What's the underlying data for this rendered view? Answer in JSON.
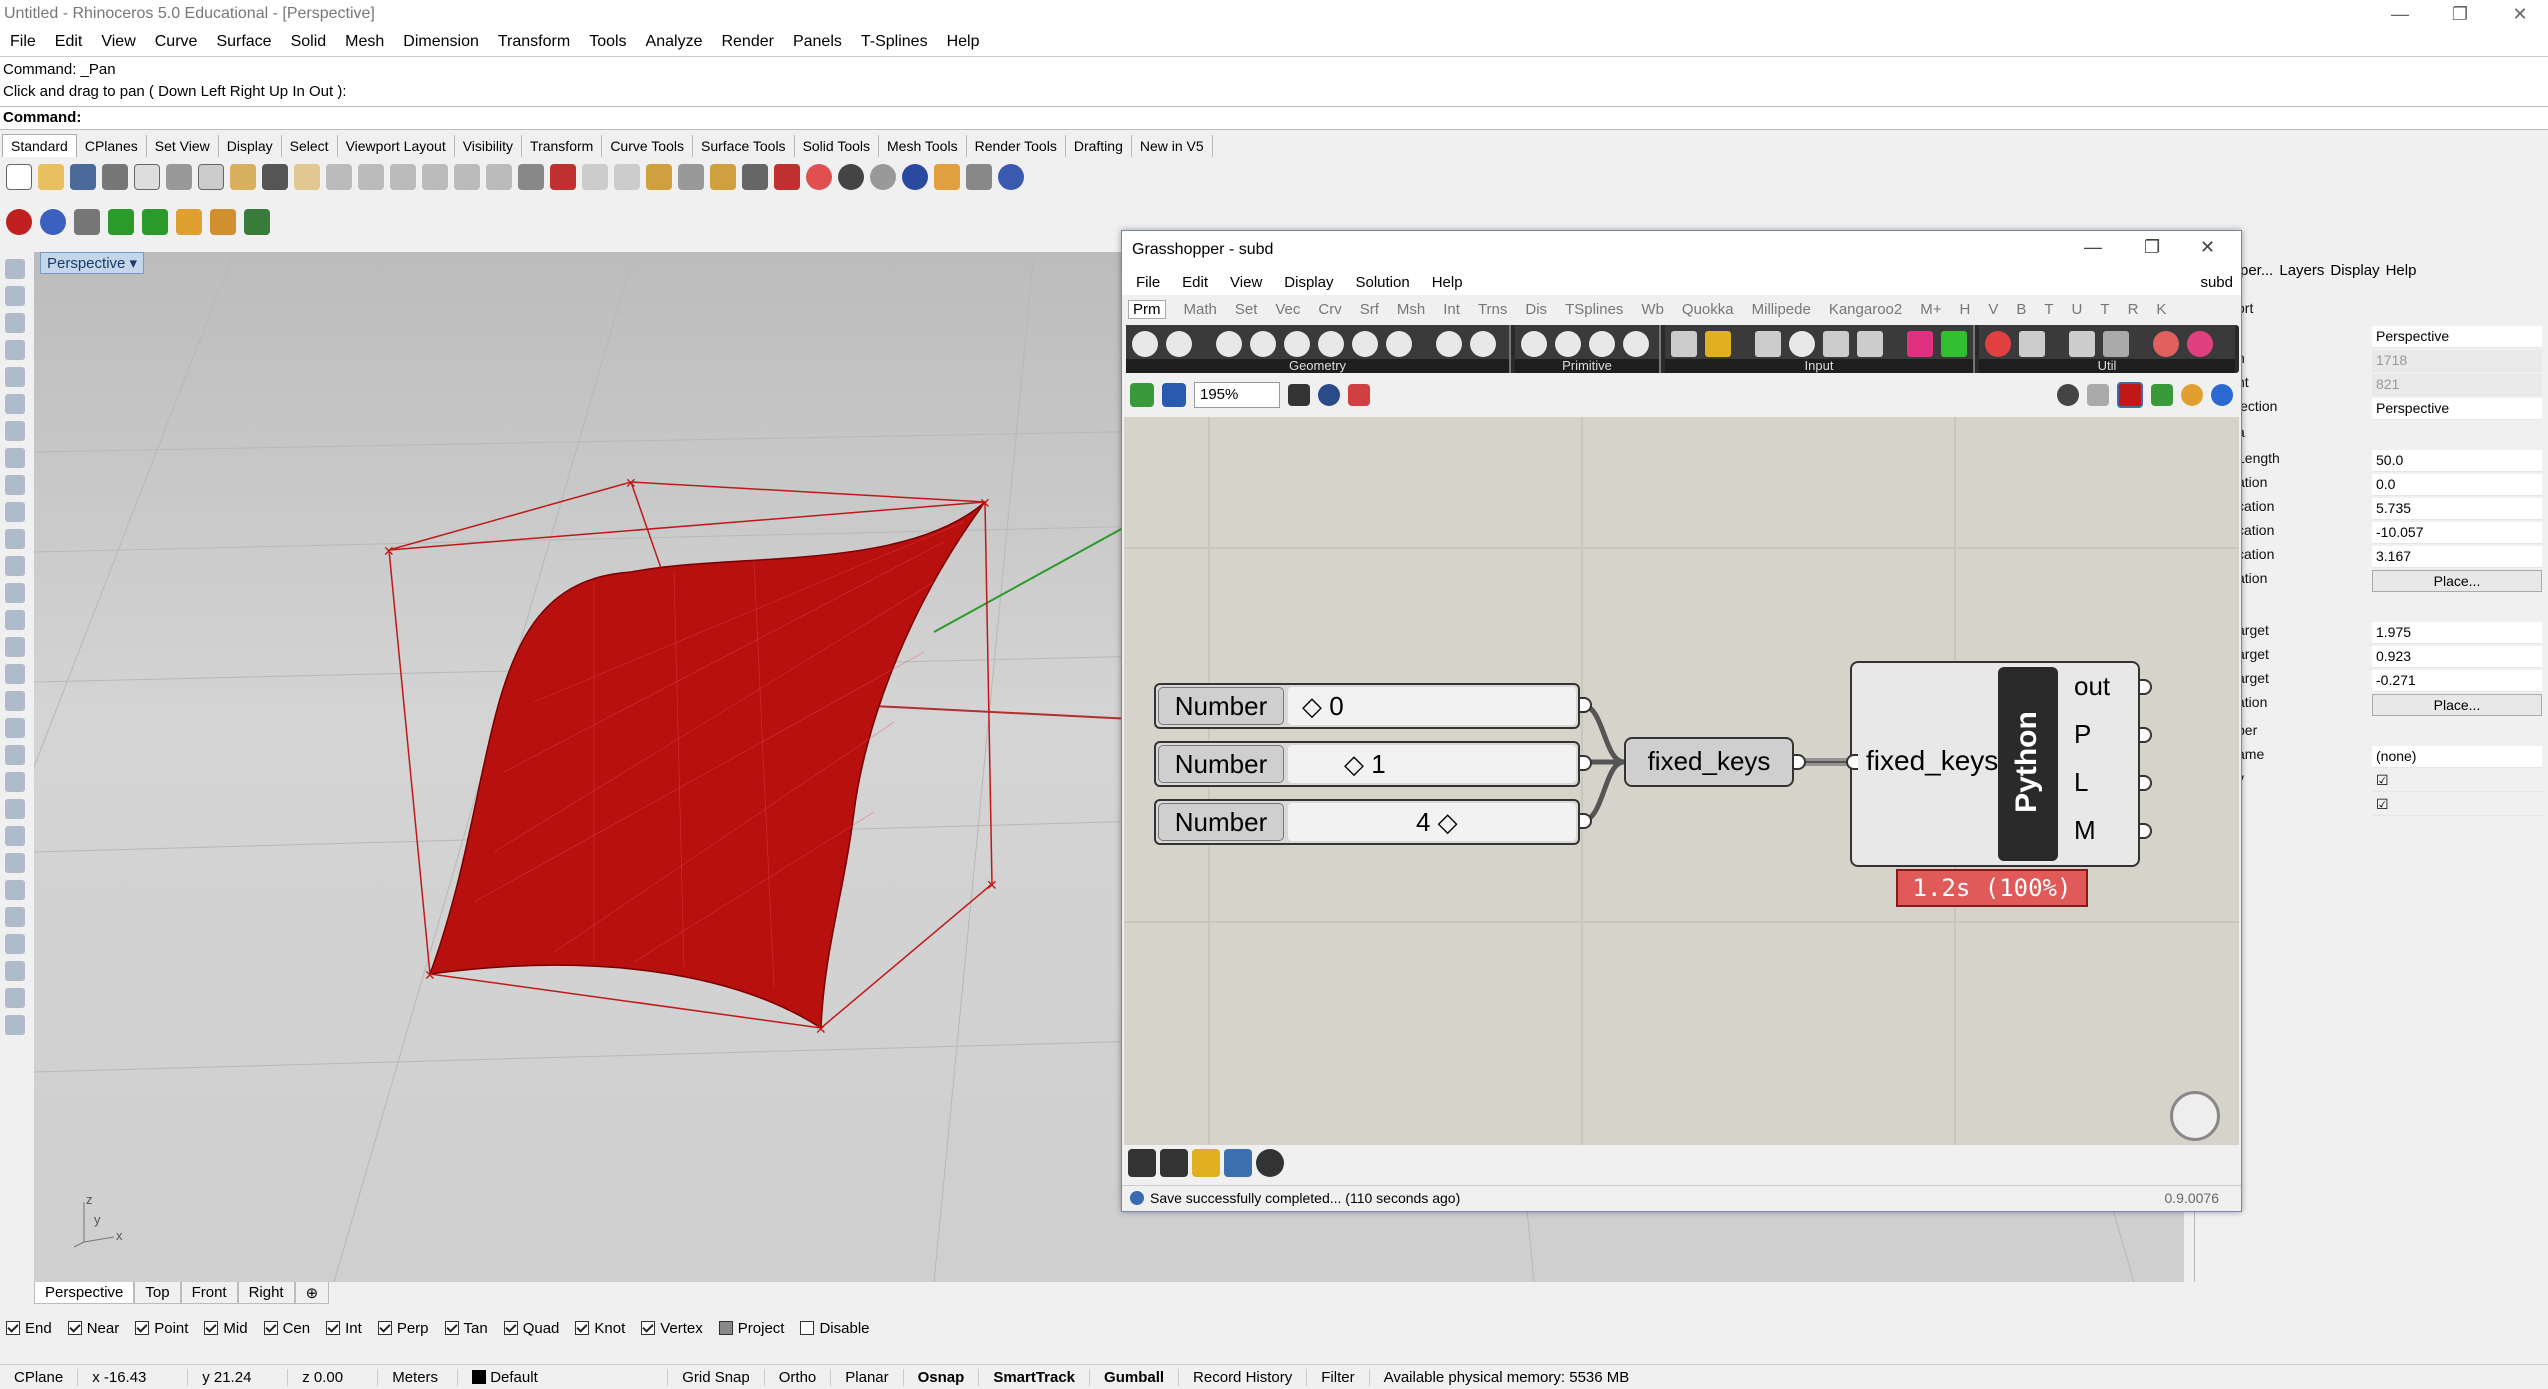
{
  "window": {
    "title": "Untitled - Rhinoceros 5.0 Educational - [Perspective]",
    "minimize": "—",
    "maximize": "❐",
    "close": "✕"
  },
  "menu": [
    "File",
    "Edit",
    "View",
    "Curve",
    "Surface",
    "Solid",
    "Mesh",
    "Dimension",
    "Transform",
    "Tools",
    "Analyze",
    "Render",
    "Panels",
    "T-Splines",
    "Help"
  ],
  "command": {
    "history1": "Command: _Pan",
    "history2": "Click and drag to pan ( Down  Left  Right  Up  In  Out ):",
    "prompt": "Command:"
  },
  "toolbar_tabs": [
    "Standard",
    "CPlanes",
    "Set View",
    "Display",
    "Select",
    "Viewport Layout",
    "Visibility",
    "Transform",
    "Curve Tools",
    "Surface Tools",
    "Solid Tools",
    "Mesh Tools",
    "Render Tools",
    "Drafting",
    "New in V5"
  ],
  "viewport": {
    "label": "Perspective ▾",
    "axis_z": "z",
    "axis_y": "y",
    "axis_x": "x"
  },
  "viewport_tabs": [
    "Perspective",
    "Top",
    "Front",
    "Right",
    "⊕"
  ],
  "osnaps": [
    {
      "label": "End",
      "checked": true
    },
    {
      "label": "Near",
      "checked": true
    },
    {
      "label": "Point",
      "checked": true
    },
    {
      "label": "Mid",
      "checked": true
    },
    {
      "label": "Cen",
      "checked": true
    },
    {
      "label": "Int",
      "checked": true
    },
    {
      "label": "Perp",
      "checked": true
    },
    {
      "label": "Tan",
      "checked": true
    },
    {
      "label": "Quad",
      "checked": true
    },
    {
      "label": "Knot",
      "checked": true
    },
    {
      "label": "Vertex",
      "checked": true
    },
    {
      "label": "Project",
      "checked": false
    },
    {
      "label": "Disable",
      "checked": false
    }
  ],
  "status": {
    "cplane": "CPlane",
    "x": "x -16.43",
    "y": "y 21.24",
    "z": "z 0.00",
    "units": "Meters",
    "layer": "Default",
    "grid_snap": "Grid Snap",
    "ortho": "Ortho",
    "planar": "Planar",
    "osnap": "Osnap",
    "smarttrack": "SmartTrack",
    "gumball": "Gumball",
    "record_history": "Record History",
    "filter": "Filter",
    "memory": "Available physical memory: 5536 MB"
  },
  "props": {
    "tabs": [
      "per...",
      "Layers",
      "Display",
      "Help"
    ],
    "rows": [
      {
        "k": "ort",
        "v": ""
      },
      {
        "k": "",
        "v": "Perspective"
      },
      {
        "k": "h",
        "v": "1718"
      },
      {
        "k": "ht",
        "v": "821"
      },
      {
        "k": "jection",
        "v": "Perspective"
      },
      {
        "k": "a",
        "v": ""
      },
      {
        "k": "Length",
        "v": "50.0"
      },
      {
        "k": "ation",
        "v": "0.0"
      },
      {
        "k": "cation",
        "v": "5.735"
      },
      {
        "k": "cation",
        "v": "-10.057"
      },
      {
        "k": "cation",
        "v": "3.167"
      },
      {
        "k": "ation",
        "v": "Place..."
      },
      {
        "k": "arget",
        "v": "1.975"
      },
      {
        "k": "arget",
        "v": "0.923"
      },
      {
        "k": "arget",
        "v": "-0.271"
      },
      {
        "k": "ation",
        "v": "Place..."
      },
      {
        "k": "per",
        "v": ""
      },
      {
        "k": "ame",
        "v": "(none)"
      },
      {
        "k": "v",
        "v": "☑"
      },
      {
        "k": "",
        "v": "☑"
      }
    ]
  },
  "grasshopper": {
    "title": "Grasshopper - subd",
    "doc": "subd",
    "menu": [
      "File",
      "Edit",
      "View",
      "Display",
      "Solution",
      "Help"
    ],
    "tabs": [
      "Prm",
      "Math",
      "Set",
      "Vec",
      "Crv",
      "Srf",
      "Msh",
      "Int",
      "Trns",
      "Dis",
      "TSplines",
      "Wb",
      "Quokka",
      "Millipede",
      "Kangaroo2",
      "M+",
      "H",
      "V",
      "B",
      "T",
      "U",
      "T",
      "R",
      "K"
    ],
    "groups": [
      "Geometry",
      "Primitive",
      "Input",
      "Util"
    ],
    "zoom": "195%",
    "numbers": [
      {
        "label": "Number",
        "value": "◇ 0"
      },
      {
        "label": "Number",
        "value": "◇ 1"
      },
      {
        "label": "Number",
        "value": "4 ◇"
      }
    ],
    "merge_label": "fixed_keys",
    "python_input": "fixed_keys",
    "python_name": "Python",
    "outputs": [
      "out",
      "P",
      "L",
      "M"
    ],
    "profiler": "1.2s (100%)",
    "status": "Save successfully completed... (110 seconds ago)",
    "version": "0.9.0076"
  }
}
